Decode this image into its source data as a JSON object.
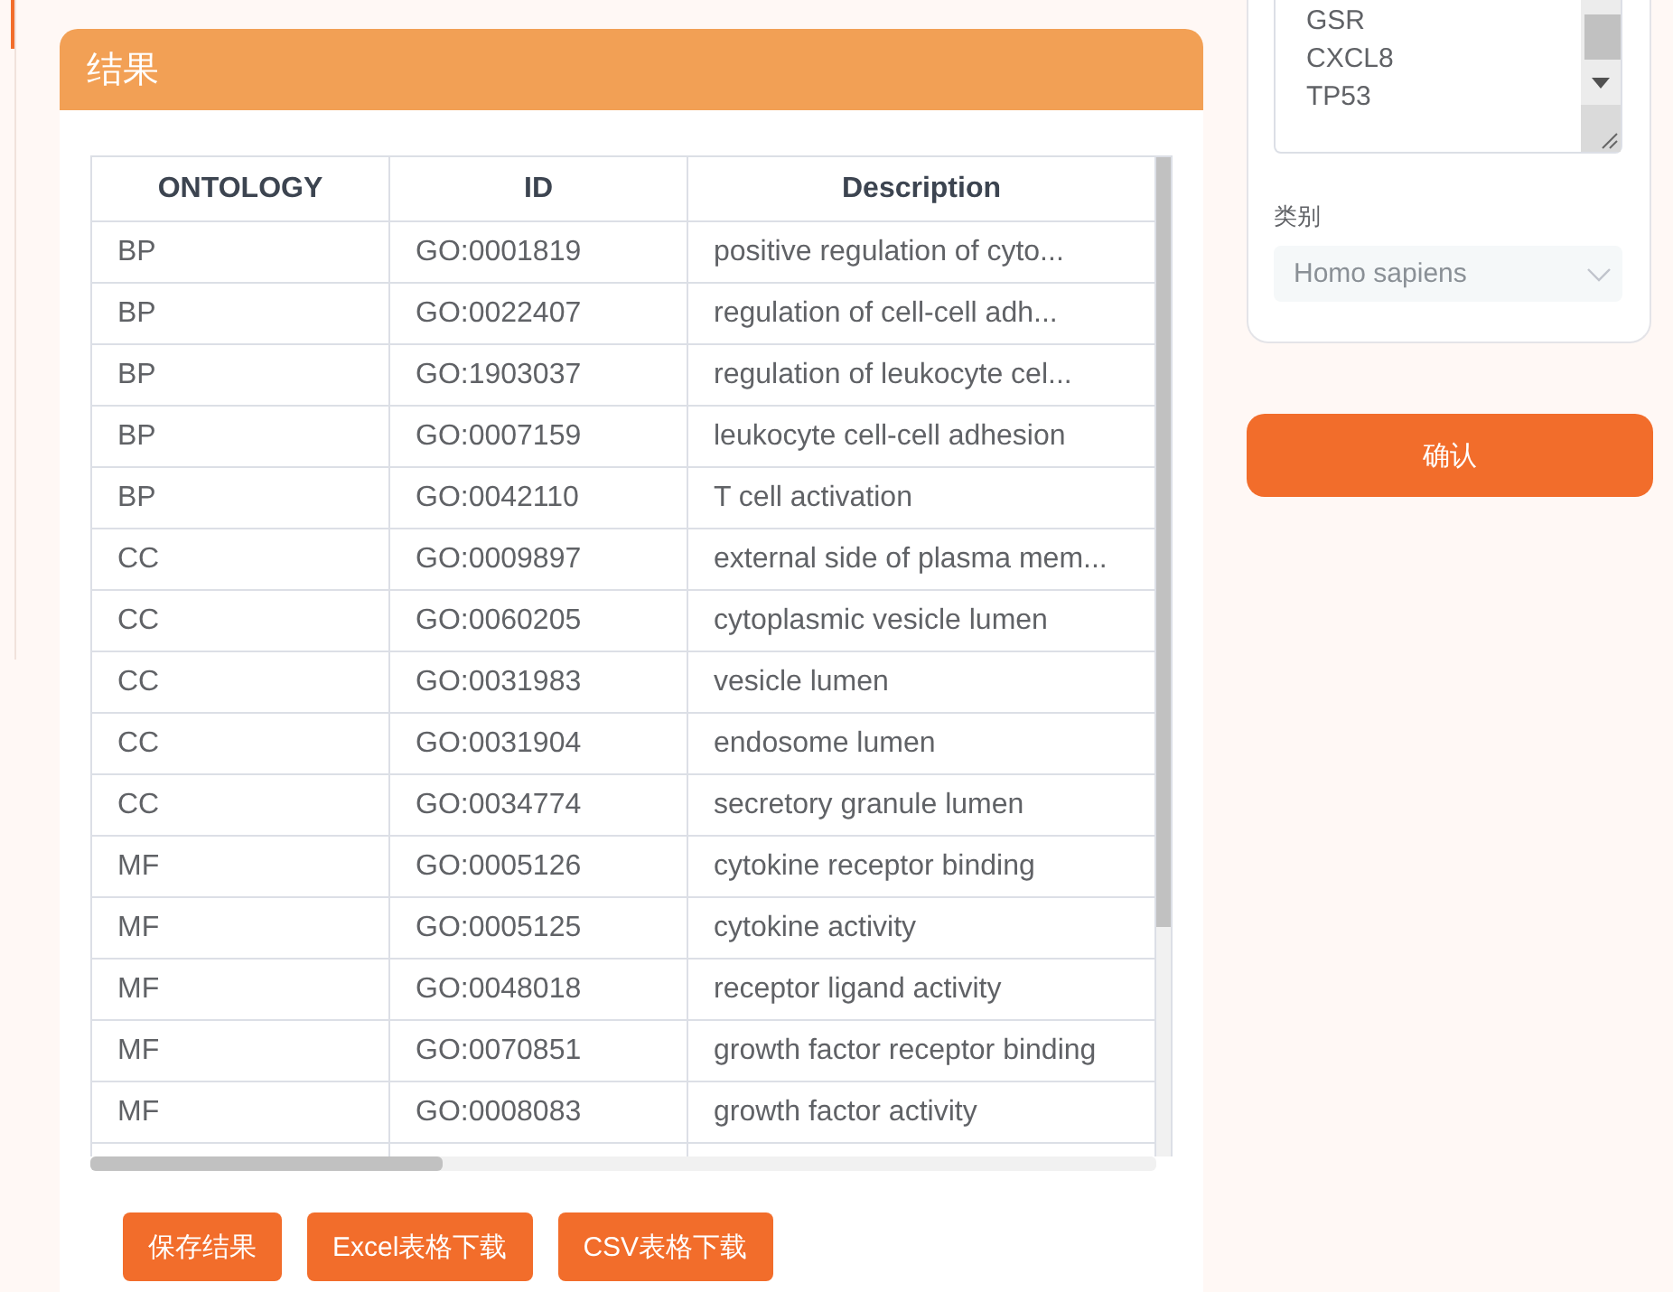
{
  "results_panel": {
    "title": "结果",
    "table": {
      "columns": [
        "ONTOLOGY",
        "ID",
        "Description"
      ],
      "rows": [
        [
          "BP",
          "GO:0001819",
          "positive regulation of cyto..."
        ],
        [
          "BP",
          "GO:0022407",
          "regulation of cell-cell adh..."
        ],
        [
          "BP",
          "GO:1903037",
          "regulation of leukocyte cel..."
        ],
        [
          "BP",
          "GO:0007159",
          "leukocyte cell-cell adhesion"
        ],
        [
          "BP",
          "GO:0042110",
          "T cell activation"
        ],
        [
          "CC",
          "GO:0009897",
          "external side of plasma mem..."
        ],
        [
          "CC",
          "GO:0060205",
          "cytoplasmic vesicle lumen"
        ],
        [
          "CC",
          "GO:0031983",
          "vesicle lumen"
        ],
        [
          "CC",
          "GO:0031904",
          "endosome lumen"
        ],
        [
          "CC",
          "GO:0034774",
          "secretory granule lumen"
        ],
        [
          "MF",
          "GO:0005126",
          "cytokine receptor binding"
        ],
        [
          "MF",
          "GO:0005125",
          "cytokine activity"
        ],
        [
          "MF",
          "GO:0048018",
          "receptor ligand activity"
        ],
        [
          "MF",
          "GO:0070851",
          "growth factor receptor binding"
        ],
        [
          "MF",
          "GO:0008083",
          "growth factor activity"
        ]
      ]
    },
    "buttons": [
      "保存结果",
      "Excel表格下载",
      "CSV表格下载"
    ]
  },
  "settings_panel": {
    "genes": [
      "GSR",
      "CXCL8",
      "TP53"
    ],
    "category_label": "类别",
    "category_value": "Homo sapiens"
  },
  "confirm_button": "确认"
}
